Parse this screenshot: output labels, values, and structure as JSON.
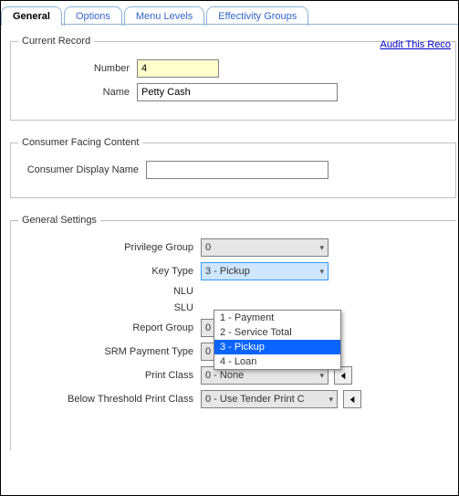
{
  "tabs": {
    "general": "General",
    "options": "Options",
    "menuLevels": "Menu Levels",
    "effectivityGroups": "Effectivity Groups"
  },
  "link": {
    "auditThisRecord": "Audit This Reco"
  },
  "currentRecord": {
    "legend": "Current Record",
    "numberLabel": "Number",
    "numberValue": "4",
    "nameLabel": "Name",
    "nameValue": "Petty Cash"
  },
  "consumerFacing": {
    "legend": "Consumer Facing Content",
    "displayNameLabel": "Consumer Display Name",
    "displayNameValue": ""
  },
  "generalSettings": {
    "legend": "General Settings",
    "privilegeGroup": {
      "label": "Privilege Group",
      "value": "0"
    },
    "keyType": {
      "label": "Key Type",
      "value": "3 - Pickup",
      "options": [
        "1 - Payment",
        "2 - Service Total",
        "3 - Pickup",
        "4 - Loan"
      ]
    },
    "nlu": {
      "label": "NLU"
    },
    "slu": {
      "label": "SLU"
    },
    "reportGroup": {
      "label": "Report Group",
      "value": "0 - None"
    },
    "srmPaymentType": {
      "label": "SRM Payment Type",
      "value": "0 - None"
    },
    "printClass": {
      "label": "Print Class",
      "value": "0 - None"
    },
    "belowThresholdPrintClass": {
      "label": "Below Threshold Print Class",
      "value": "0 - Use Tender Print C"
    }
  }
}
